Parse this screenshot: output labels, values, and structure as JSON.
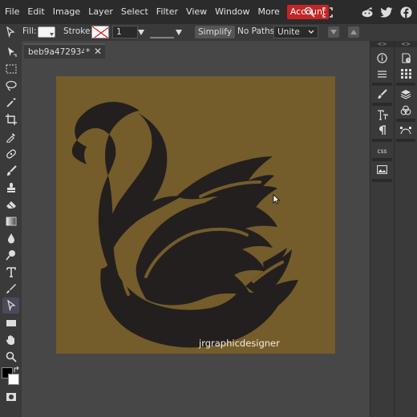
{
  "menu": {
    "items": [
      "File",
      "Edit",
      "Image",
      "Layer",
      "Select",
      "Filter",
      "View",
      "Window",
      "More"
    ],
    "account": "Account",
    "account_color": "#c42525"
  },
  "menubar_icons": [
    "search-icon",
    "fullscreen-icon",
    "reddit-icon",
    "twitter-icon",
    "facebook-icon"
  ],
  "options": {
    "fill_label": "Fill:",
    "stroke_label": "Stroke:",
    "stroke_width": "1 px",
    "simplify": "Simplify",
    "no_paths_label": "No Paths:",
    "unite": "Unite"
  },
  "document": {
    "tab_name": "beb9a472934",
    "tab_modified": "*",
    "canvas_color": "#745c2b",
    "swan_color": "#231f1e",
    "watermark": "jrgraphicdesigner"
  },
  "panels": {
    "css_label": "css"
  },
  "tools": [
    "move-tool-icon",
    "marquee-tool-icon",
    "lasso-tool-icon",
    "magic-wand-icon",
    "crop-tool-icon",
    "eyedropper-icon",
    "healing-brush-icon",
    "brush-tool-icon",
    "clone-stamp-icon",
    "eraser-icon",
    "gradient-tool-icon",
    "blur-tool-icon",
    "dodge-tool-icon",
    "type-tool-icon",
    "pen-tool-icon",
    "path-select-icon",
    "shape-tool-icon",
    "hand-tool-icon",
    "zoom-tool-icon",
    "color-swatches",
    "quick-mask-icon"
  ]
}
